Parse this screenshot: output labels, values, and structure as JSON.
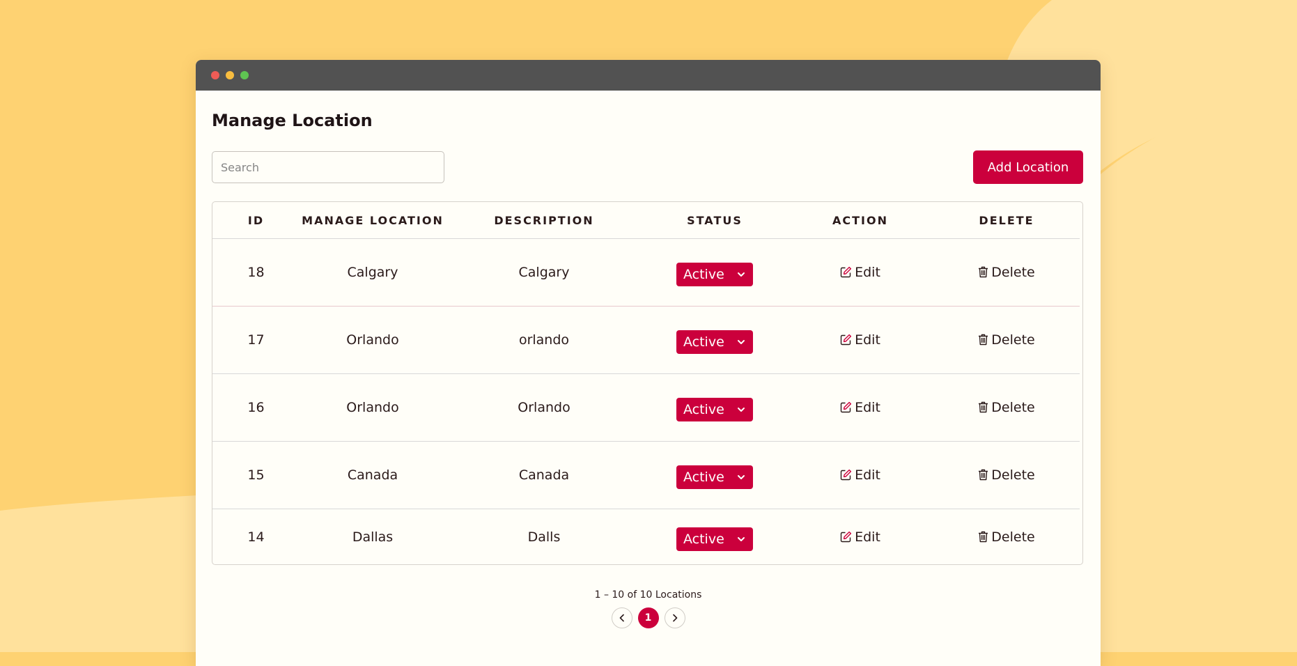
{
  "page": {
    "title": "Manage Location",
    "search_placeholder": "Search",
    "add_button_label": "Add Location"
  },
  "table": {
    "columns": [
      "ID",
      "MANAGE LOCATION",
      "DESCRIPTION",
      "STATUS",
      "ACTION",
      "DELETE"
    ],
    "rows": [
      {
        "id": "18",
        "location": "Calgary",
        "description": "Calgary",
        "status": "Active"
      },
      {
        "id": "17",
        "location": "Orlando",
        "description": "orlando",
        "status": "Active"
      },
      {
        "id": "16",
        "location": "Orlando",
        "description": "Orlando",
        "status": "Active"
      },
      {
        "id": "15",
        "location": "Canada",
        "description": "Canada",
        "status": "Active"
      },
      {
        "id": "14",
        "location": "Dallas",
        "description": "Dalls",
        "status": "Active"
      }
    ],
    "edit_label": "Edit",
    "delete_label": "Delete"
  },
  "pagination": {
    "summary": "1 – 10 of 10 Locations",
    "current_page": "1"
  },
  "icons": {
    "edit": "edit-icon",
    "delete": "trash-icon",
    "dropdown": "chevron-down-icon",
    "prev": "chevron-left-icon",
    "next": "chevron-right-icon"
  },
  "colors": {
    "accent": "#cb003c",
    "background": "#fed272",
    "titlebar": "#525252"
  }
}
